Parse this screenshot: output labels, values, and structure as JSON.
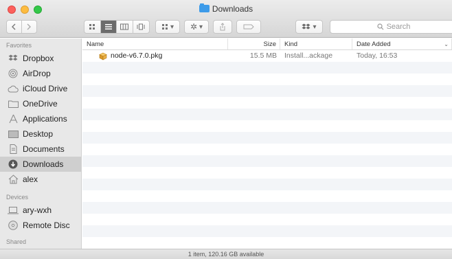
{
  "window": {
    "title": "Downloads",
    "status": "1 item, 120.16 GB available"
  },
  "toolbar": {
    "search_placeholder": "Search",
    "view_mode_selected": "list"
  },
  "sidebar": {
    "sections": [
      {
        "label": "Favorites",
        "items": [
          {
            "label": "Dropbox",
            "icon": "dropbox-icon"
          },
          {
            "label": "AirDrop",
            "icon": "airdrop-icon"
          },
          {
            "label": "iCloud Drive",
            "icon": "cloud-icon"
          },
          {
            "label": "OneDrive",
            "icon": "folder-icon"
          },
          {
            "label": "Applications",
            "icon": "applications-icon"
          },
          {
            "label": "Desktop",
            "icon": "desktop-icon"
          },
          {
            "label": "Documents",
            "icon": "documents-icon"
          },
          {
            "label": "Downloads",
            "icon": "downloads-icon",
            "selected": true
          },
          {
            "label": "alex",
            "icon": "home-icon"
          }
        ]
      },
      {
        "label": "Devices",
        "items": [
          {
            "label": "ary-wxh",
            "icon": "laptop-icon"
          },
          {
            "label": "Remote Disc",
            "icon": "disc-icon"
          }
        ]
      },
      {
        "label": "Shared",
        "items": []
      }
    ]
  },
  "list": {
    "columns": {
      "name": "Name",
      "size": "Size",
      "kind": "Kind",
      "date": "Date Added"
    },
    "files": [
      {
        "name": "node-v6.7.0.pkg",
        "size": "15.5 MB",
        "kind": "Install...ackage",
        "date": "Today, 16:53",
        "icon": "package-icon"
      }
    ]
  },
  "colors": {
    "close": "#fc605c",
    "minimize": "#fdbc40",
    "zoom": "#34c84a",
    "folder_accent": "#3d9be9",
    "sidebar_bg": "#e8e8e8",
    "selection_bg": "#cfcfcf"
  }
}
